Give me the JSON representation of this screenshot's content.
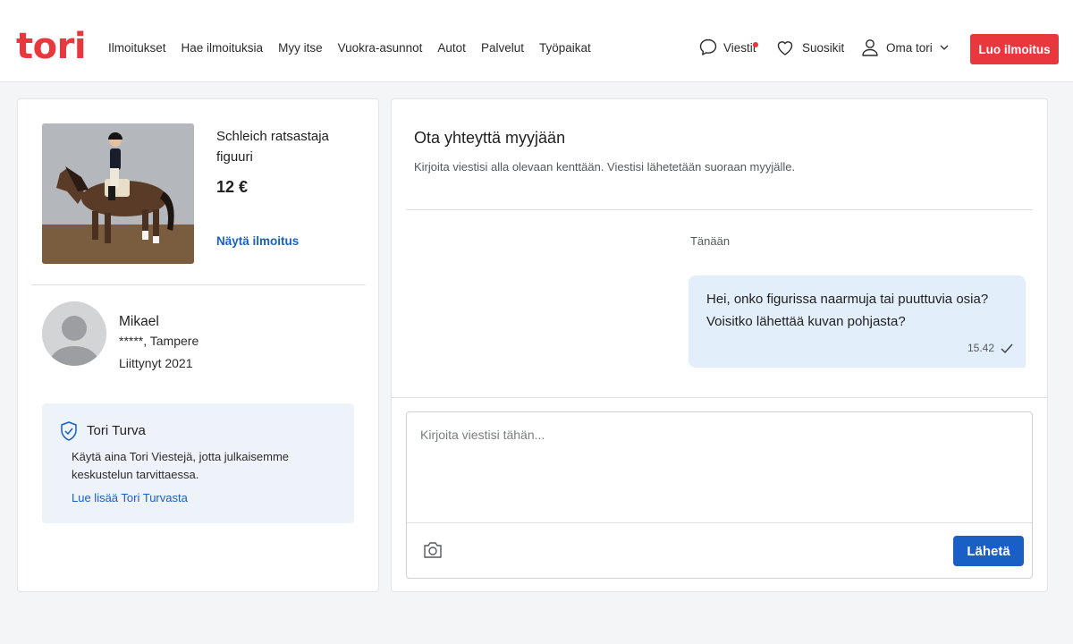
{
  "header": {
    "logo": "tori",
    "nav": [
      "Ilmoitukset",
      "Hae ilmoituksia",
      "Myy itse",
      "Vuokra-asunnot",
      "Autot",
      "Palvelut",
      "Työpaikat"
    ],
    "messages_label": "Viestit",
    "favorites_label": "Suosikit",
    "account_label": "Oma tori",
    "create_label": "Luo ilmoitus"
  },
  "listing": {
    "title": "Schleich ratsastaja figuuri",
    "price": "12 €",
    "show_link": "Näytä ilmoitus"
  },
  "seller": {
    "name": "Mikael",
    "location": "*****, Tampere",
    "joined": "Liittynyt 2021"
  },
  "safety": {
    "title": "Tori Turva",
    "text": "Käytä aina Tori Viestejä, jotta julkaisemme keskustelun tarvittaessa.",
    "link": "Lue lisää Tori Turvasta"
  },
  "contact": {
    "title": "Ota yhteyttä myyjään",
    "subtitle": "Kirjoita viestisi alla olevaan kenttään. Viestisi lähetetään suoraan myyjälle.",
    "day_label": "Tänään"
  },
  "message": {
    "text": "Hei, onko figurissa naarmuja tai puuttuvia osia? Voisitko lähettää kuvan pohjasta?",
    "time": "15.42"
  },
  "composer": {
    "placeholder": "Kirjoita viestisi tähän...",
    "send_label": "Lähetä"
  },
  "colors": {
    "brand": "#e8383d",
    "link": "#1a5fc4",
    "bubble": "#e3eefb",
    "safety_bg": "#eef3fa"
  },
  "icons": [
    "chat-bubble-icon",
    "heart-icon",
    "user-icon",
    "chevron-down-icon",
    "shield-check-icon",
    "check-icon",
    "camera-icon"
  ]
}
